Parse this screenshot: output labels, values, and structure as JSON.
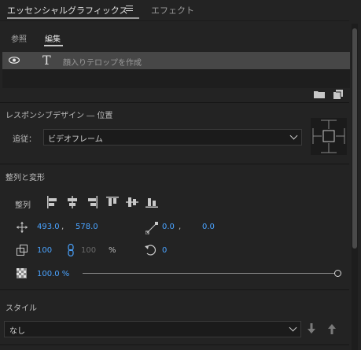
{
  "tabs": {
    "essential_graphics": "エッセンシャルグラフィックス",
    "effects": "エフェクト"
  },
  "subtabs": {
    "browse": "参照",
    "edit": "編集"
  },
  "layers": [
    {
      "name": "顔入りテロップを作成",
      "type": "text-icon"
    }
  ],
  "responsive": {
    "title": "レスポンシブデザイン ― 位置",
    "follow_label": "追従：",
    "follow_value": "ビデオフレーム"
  },
  "align_transform": {
    "title": "整列と変形",
    "align_label": "整列",
    "position_x": "493.0",
    "position_y": "578.0",
    "anchor_x": "0.0",
    "anchor_y": "0.0",
    "scale": "100",
    "scale_linked": "100",
    "scale_unit": "%",
    "rotation": "0",
    "opacity": "100.0 %",
    "opacity_fraction": 1.0
  },
  "style": {
    "title": "スタイル",
    "value": "なし"
  },
  "colors": {
    "accent": "#4aa3ff",
    "panel": "#232323",
    "selected_row": "#474747"
  }
}
